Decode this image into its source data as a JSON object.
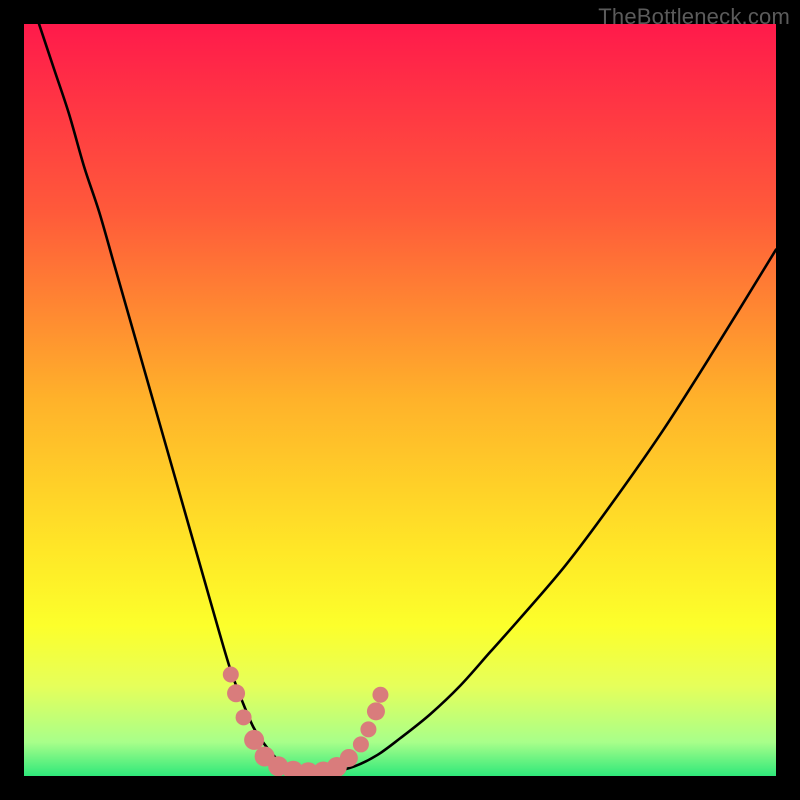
{
  "watermark": "TheBottleneck.com",
  "chart_data": {
    "type": "line",
    "title": "",
    "xlabel": "",
    "ylabel": "",
    "xlim": [
      0,
      100
    ],
    "ylim": [
      0,
      100
    ],
    "grid": false,
    "legend": false,
    "background_gradient": {
      "stops": [
        {
          "pos": 0.0,
          "color": "#ff1a4b"
        },
        {
          "pos": 0.25,
          "color": "#ff5a3a"
        },
        {
          "pos": 0.5,
          "color": "#ffb22a"
        },
        {
          "pos": 0.7,
          "color": "#ffe727"
        },
        {
          "pos": 0.8,
          "color": "#fcff2b"
        },
        {
          "pos": 0.88,
          "color": "#e6ff5a"
        },
        {
          "pos": 0.955,
          "color": "#a8ff8a"
        },
        {
          "pos": 1.0,
          "color": "#2fe87a"
        }
      ]
    },
    "series": [
      {
        "name": "bottleneck-curve",
        "x": [
          0,
          2,
          4,
          6,
          8,
          10,
          12,
          14,
          16,
          18,
          20,
          22,
          24,
          26,
          27.5,
          29,
          30.5,
          32,
          33.5,
          35,
          37,
          39,
          41,
          44,
          47,
          50,
          54,
          58,
          62,
          66,
          72,
          78,
          85,
          92,
          100
        ],
        "y": [
          106,
          100,
          94,
          88,
          81,
          75,
          68,
          61,
          54,
          47,
          40,
          33,
          26,
          19,
          14,
          10,
          6.5,
          4.2,
          2.4,
          1.2,
          0.5,
          0.3,
          0.5,
          1.3,
          2.8,
          5.0,
          8.2,
          12,
          16.5,
          21,
          28,
          36,
          46,
          57,
          70
        ]
      }
    ],
    "markers": {
      "name": "highlight-dots",
      "color": "#d97c7c",
      "points": [
        {
          "x": 27.5,
          "y": 13.5,
          "r": 8
        },
        {
          "x": 28.2,
          "y": 11.0,
          "r": 9
        },
        {
          "x": 29.2,
          "y": 7.8,
          "r": 8
        },
        {
          "x": 30.6,
          "y": 4.8,
          "r": 10
        },
        {
          "x": 32.0,
          "y": 2.6,
          "r": 10
        },
        {
          "x": 33.8,
          "y": 1.3,
          "r": 10
        },
        {
          "x": 35.8,
          "y": 0.7,
          "r": 10
        },
        {
          "x": 37.8,
          "y": 0.5,
          "r": 10
        },
        {
          "x": 39.8,
          "y": 0.6,
          "r": 10
        },
        {
          "x": 41.6,
          "y": 1.2,
          "r": 10
        },
        {
          "x": 43.2,
          "y": 2.4,
          "r": 9
        },
        {
          "x": 44.8,
          "y": 4.2,
          "r": 8
        },
        {
          "x": 45.8,
          "y": 6.2,
          "r": 8
        },
        {
          "x": 46.8,
          "y": 8.6,
          "r": 9
        },
        {
          "x": 47.4,
          "y": 10.8,
          "r": 8
        }
      ]
    }
  }
}
